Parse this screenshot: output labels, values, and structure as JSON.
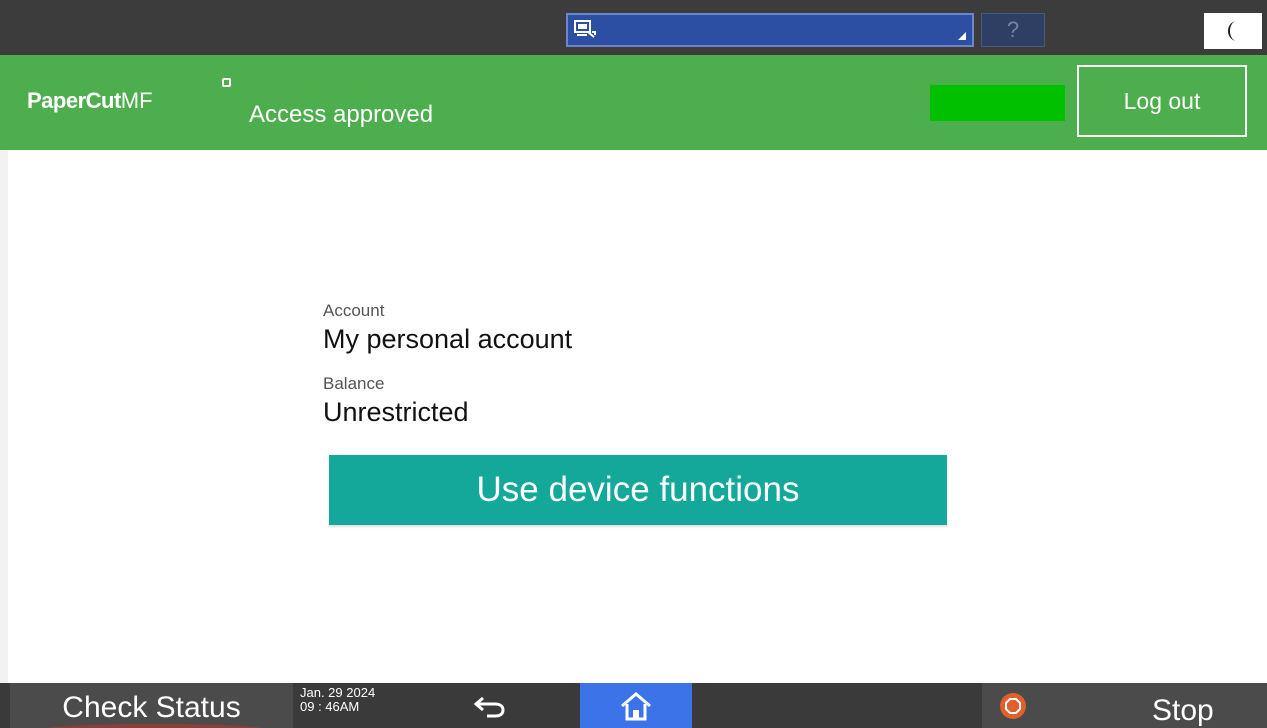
{
  "top_bar": {
    "panel_selector_icon": "screen-switch-icon",
    "help_label": "?",
    "night_icon": "crescent-moon-icon"
  },
  "header": {
    "brand_strong": "PaperCut",
    "brand_light": "MF",
    "status_text": "Access approved",
    "logout_label": "Log out",
    "colors": {
      "header_bg": "#4cae4c",
      "indicator": "#00c000"
    }
  },
  "account": {
    "label": "Account",
    "value": "My personal account"
  },
  "balance": {
    "label": "Balance",
    "value": "Unrestricted"
  },
  "primary_action": {
    "label": "Use device functions",
    "color": "#13a89a"
  },
  "bottom_bar": {
    "check_status_label": "Check Status",
    "date": "Jan. 29 2024",
    "time": "09 : 46AM",
    "back_icon": "back-arrow-icon",
    "home_icon": "home-icon",
    "stop_icon": "stop-icon",
    "stop_label": "Stop",
    "colors": {
      "home_bg": "#3d73e8",
      "stop_icon": "#e0602d"
    }
  }
}
